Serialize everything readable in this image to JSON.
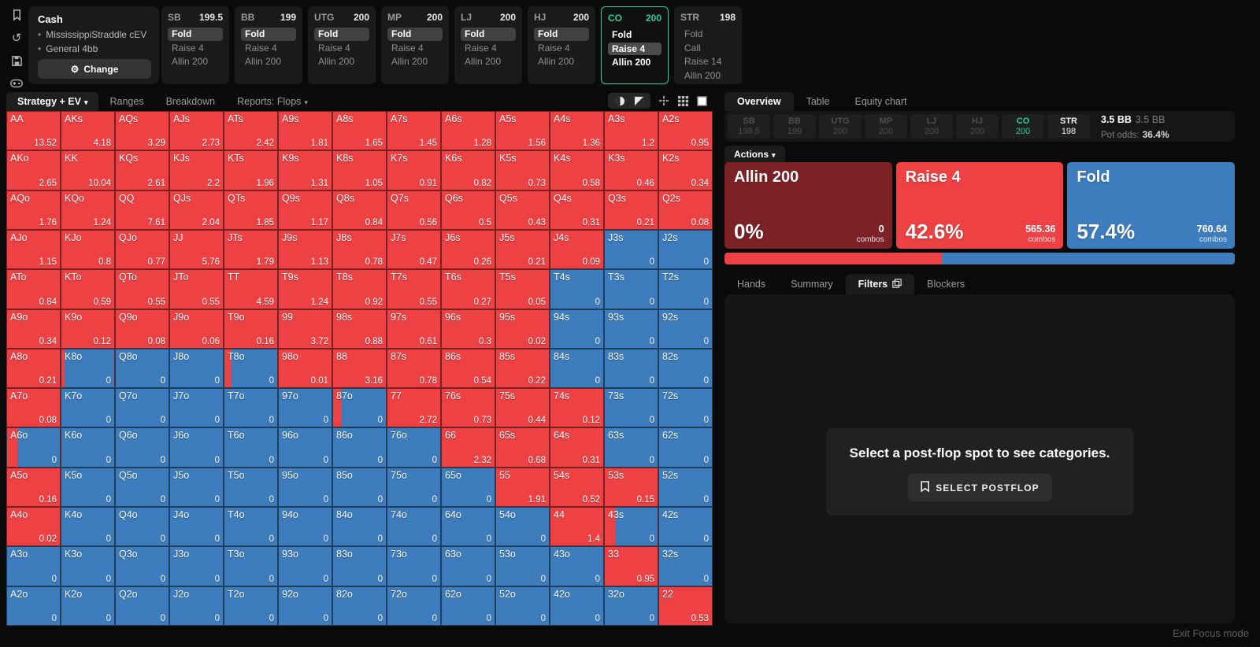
{
  "toolbar_left": {
    "icons": [
      "bookmark-icon",
      "reset-icon",
      "save-icon",
      "gamepad-icon",
      "stack-depth-icon"
    ]
  },
  "config_panel": {
    "title": "Cash",
    "items": [
      "MississippiStraddle cEV",
      "General 4bb"
    ],
    "change_label": "Change",
    "gear_icon": "⚙"
  },
  "position_panels": [
    {
      "name": "SB",
      "stack": "199.5",
      "active": false,
      "actions": [
        {
          "label": "Fold",
          "state": "chosen"
        },
        {
          "label": "Raise 4",
          "state": "dim"
        },
        {
          "label": "Allin 200",
          "state": "dim"
        }
      ]
    },
    {
      "name": "BB",
      "stack": "199",
      "active": false,
      "actions": [
        {
          "label": "Fold",
          "state": "chosen"
        },
        {
          "label": "Raise 4",
          "state": "dim"
        },
        {
          "label": "Allin 200",
          "state": "dim"
        }
      ]
    },
    {
      "name": "UTG",
      "stack": "200",
      "active": false,
      "actions": [
        {
          "label": "Fold",
          "state": "chosen"
        },
        {
          "label": "Raise 4",
          "state": "dim"
        },
        {
          "label": "Allin 200",
          "state": "dim"
        }
      ]
    },
    {
      "name": "MP",
      "stack": "200",
      "active": false,
      "actions": [
        {
          "label": "Fold",
          "state": "chosen"
        },
        {
          "label": "Raise 4",
          "state": "dim"
        },
        {
          "label": "Allin 200",
          "state": "dim"
        }
      ]
    },
    {
      "name": "LJ",
      "stack": "200",
      "active": false,
      "actions": [
        {
          "label": "Fold",
          "state": "chosen"
        },
        {
          "label": "Raise 4",
          "state": "dim"
        },
        {
          "label": "Allin 200",
          "state": "dim"
        }
      ]
    },
    {
      "name": "HJ",
      "stack": "200",
      "active": false,
      "actions": [
        {
          "label": "Fold",
          "state": "chosen"
        },
        {
          "label": "Raise 4",
          "state": "dim"
        },
        {
          "label": "Allin 200",
          "state": "dim"
        }
      ]
    },
    {
      "name": "CO",
      "stack": "200",
      "active": true,
      "actions": [
        {
          "label": "Fold",
          "state": "white"
        },
        {
          "label": "Raise 4",
          "state": "chosen-white"
        },
        {
          "label": "Allin 200",
          "state": "white"
        }
      ]
    },
    {
      "name": "STR",
      "stack": "198",
      "active": false,
      "actions": [
        {
          "label": "Fold",
          "state": "dim"
        },
        {
          "label": "Call",
          "state": "dim"
        },
        {
          "label": "Raise 14",
          "state": "dim"
        },
        {
          "label": "Allin 200",
          "state": "dim"
        }
      ]
    }
  ],
  "left_tabs": {
    "strategy": "Strategy + EV",
    "ranges": "Ranges",
    "breakdown": "Breakdown",
    "reports": "Reports: Flops"
  },
  "matrix_toolbar": {
    "icons": [
      "pie-icon",
      "contrast-square-icon",
      "move-icon",
      "grid-icon",
      "square-icon"
    ]
  },
  "colors": {
    "raise_red": "#ee4144",
    "fold_blue": "#3d7cbd",
    "allin_dark_red": "#7c2125",
    "accent_green": "#25d0a0"
  },
  "matrix": {
    "rows": [
      [
        {
          "h": "AA",
          "v": "13.52",
          "c": "r"
        },
        {
          "h": "AKs",
          "v": "4.18",
          "c": "r"
        },
        {
          "h": "AQs",
          "v": "3.29",
          "c": "r"
        },
        {
          "h": "AJs",
          "v": "2.73",
          "c": "r"
        },
        {
          "h": "ATs",
          "v": "2.42",
          "c": "r"
        },
        {
          "h": "A9s",
          "v": "1.81",
          "c": "r"
        },
        {
          "h": "A8s",
          "v": "1.65",
          "c": "r"
        },
        {
          "h": "A7s",
          "v": "1.45",
          "c": "r"
        },
        {
          "h": "A6s",
          "v": "1.28",
          "c": "r"
        },
        {
          "h": "A5s",
          "v": "1.56",
          "c": "r"
        },
        {
          "h": "A4s",
          "v": "1.36",
          "c": "r"
        },
        {
          "h": "A3s",
          "v": "1.2",
          "c": "r"
        },
        {
          "h": "A2s",
          "v": "0.95",
          "c": "r"
        }
      ],
      [
        {
          "h": "AKo",
          "v": "2.65",
          "c": "r"
        },
        {
          "h": "KK",
          "v": "10.04",
          "c": "r"
        },
        {
          "h": "KQs",
          "v": "2.61",
          "c": "r"
        },
        {
          "h": "KJs",
          "v": "2.2",
          "c": "r"
        },
        {
          "h": "KTs",
          "v": "1.96",
          "c": "r"
        },
        {
          "h": "K9s",
          "v": "1.31",
          "c": "r"
        },
        {
          "h": "K8s",
          "v": "1.05",
          "c": "r"
        },
        {
          "h": "K7s",
          "v": "0.91",
          "c": "r"
        },
        {
          "h": "K6s",
          "v": "0.82",
          "c": "r"
        },
        {
          "h": "K5s",
          "v": "0.73",
          "c": "r"
        },
        {
          "h": "K4s",
          "v": "0.58",
          "c": "r"
        },
        {
          "h": "K3s",
          "v": "0.46",
          "c": "r"
        },
        {
          "h": "K2s",
          "v": "0.34",
          "c": "r"
        }
      ],
      [
        {
          "h": "AQo",
          "v": "1.76",
          "c": "r"
        },
        {
          "h": "KQo",
          "v": "1.24",
          "c": "r"
        },
        {
          "h": "QQ",
          "v": "7.61",
          "c": "r"
        },
        {
          "h": "QJs",
          "v": "2.04",
          "c": "r"
        },
        {
          "h": "QTs",
          "v": "1.85",
          "c": "r"
        },
        {
          "h": "Q9s",
          "v": "1.17",
          "c": "r"
        },
        {
          "h": "Q8s",
          "v": "0.84",
          "c": "r"
        },
        {
          "h": "Q7s",
          "v": "0.56",
          "c": "r"
        },
        {
          "h": "Q6s",
          "v": "0.5",
          "c": "r"
        },
        {
          "h": "Q5s",
          "v": "0.43",
          "c": "r"
        },
        {
          "h": "Q4s",
          "v": "0.31",
          "c": "r"
        },
        {
          "h": "Q3s",
          "v": "0.21",
          "c": "r"
        },
        {
          "h": "Q2s",
          "v": "0.08",
          "c": "r"
        }
      ],
      [
        {
          "h": "AJo",
          "v": "1.15",
          "c": "r"
        },
        {
          "h": "KJo",
          "v": "0.8",
          "c": "r"
        },
        {
          "h": "QJo",
          "v": "0.77",
          "c": "r"
        },
        {
          "h": "JJ",
          "v": "5.76",
          "c": "r"
        },
        {
          "h": "JTs",
          "v": "1.79",
          "c": "r"
        },
        {
          "h": "J9s",
          "v": "1.13",
          "c": "r"
        },
        {
          "h": "J8s",
          "v": "0.78",
          "c": "r"
        },
        {
          "h": "J7s",
          "v": "0.47",
          "c": "r"
        },
        {
          "h": "J6s",
          "v": "0.26",
          "c": "r"
        },
        {
          "h": "J5s",
          "v": "0.21",
          "c": "r"
        },
        {
          "h": "J4s",
          "v": "0.09",
          "c": "r"
        },
        {
          "h": "J3s",
          "v": "0",
          "c": "b"
        },
        {
          "h": "J2s",
          "v": "0",
          "c": "b"
        }
      ],
      [
        {
          "h": "ATo",
          "v": "0.84",
          "c": "r"
        },
        {
          "h": "KTo",
          "v": "0.59",
          "c": "r"
        },
        {
          "h": "QTo",
          "v": "0.55",
          "c": "r"
        },
        {
          "h": "JTo",
          "v": "0.55",
          "c": "r"
        },
        {
          "h": "TT",
          "v": "4.59",
          "c": "r"
        },
        {
          "h": "T9s",
          "v": "1.24",
          "c": "r"
        },
        {
          "h": "T8s",
          "v": "0.92",
          "c": "r"
        },
        {
          "h": "T7s",
          "v": "0.55",
          "c": "r"
        },
        {
          "h": "T6s",
          "v": "0.27",
          "c": "r"
        },
        {
          "h": "T5s",
          "v": "0.05",
          "c": "r"
        },
        {
          "h": "T4s",
          "v": "0",
          "c": "b"
        },
        {
          "h": "T3s",
          "v": "0",
          "c": "b"
        },
        {
          "h": "T2s",
          "v": "0",
          "c": "b"
        }
      ],
      [
        {
          "h": "A9o",
          "v": "0.34",
          "c": "r"
        },
        {
          "h": "K9o",
          "v": "0.12",
          "c": "r"
        },
        {
          "h": "Q9o",
          "v": "0.08",
          "c": "r"
        },
        {
          "h": "J9o",
          "v": "0.06",
          "c": "r"
        },
        {
          "h": "T9o",
          "v": "0.16",
          "c": "r"
        },
        {
          "h": "99",
          "v": "3.72",
          "c": "r"
        },
        {
          "h": "98s",
          "v": "0.88",
          "c": "r"
        },
        {
          "h": "97s",
          "v": "0.61",
          "c": "r"
        },
        {
          "h": "96s",
          "v": "0.3",
          "c": "r"
        },
        {
          "h": "95s",
          "v": "0.02",
          "c": "r"
        },
        {
          "h": "94s",
          "v": "0",
          "c": "b"
        },
        {
          "h": "93s",
          "v": "0",
          "c": "b"
        },
        {
          "h": "92s",
          "v": "0",
          "c": "b"
        }
      ],
      [
        {
          "h": "A8o",
          "v": "0.21",
          "c": "r"
        },
        {
          "h": "K8o",
          "v": "0",
          "c": "m",
          "f": 0.06
        },
        {
          "h": "Q8o",
          "v": "0",
          "c": "b"
        },
        {
          "h": "J8o",
          "v": "0",
          "c": "b"
        },
        {
          "h": "T8o",
          "v": "0",
          "c": "m",
          "f": 0.13
        },
        {
          "h": "98o",
          "v": "0.01",
          "c": "r"
        },
        {
          "h": "88",
          "v": "3.16",
          "c": "r"
        },
        {
          "h": "87s",
          "v": "0.78",
          "c": "r"
        },
        {
          "h": "86s",
          "v": "0.54",
          "c": "r"
        },
        {
          "h": "85s",
          "v": "0.22",
          "c": "r"
        },
        {
          "h": "84s",
          "v": "0",
          "c": "b"
        },
        {
          "h": "83s",
          "v": "0",
          "c": "b"
        },
        {
          "h": "82s",
          "v": "0",
          "c": "b"
        }
      ],
      [
        {
          "h": "A7o",
          "v": "0.08",
          "c": "r"
        },
        {
          "h": "K7o",
          "v": "0",
          "c": "b"
        },
        {
          "h": "Q7o",
          "v": "0",
          "c": "b"
        },
        {
          "h": "J7o",
          "v": "0",
          "c": "b"
        },
        {
          "h": "T7o",
          "v": "0",
          "c": "b"
        },
        {
          "h": "97o",
          "v": "0",
          "c": "b"
        },
        {
          "h": "87o",
          "v": "0",
          "c": "m",
          "f": 0.16
        },
        {
          "h": "77",
          "v": "2.72",
          "c": "r"
        },
        {
          "h": "76s",
          "v": "0.73",
          "c": "r"
        },
        {
          "h": "75s",
          "v": "0.44",
          "c": "r"
        },
        {
          "h": "74s",
          "v": "0.12",
          "c": "r"
        },
        {
          "h": "73s",
          "v": "0",
          "c": "b"
        },
        {
          "h": "72s",
          "v": "0",
          "c": "b"
        }
      ],
      [
        {
          "h": "A6o",
          "v": "0",
          "c": "m",
          "f": 0.2
        },
        {
          "h": "K6o",
          "v": "0",
          "c": "b"
        },
        {
          "h": "Q6o",
          "v": "0",
          "c": "b"
        },
        {
          "h": "J6o",
          "v": "0",
          "c": "b"
        },
        {
          "h": "T6o",
          "v": "0",
          "c": "b"
        },
        {
          "h": "96o",
          "v": "0",
          "c": "b"
        },
        {
          "h": "86o",
          "v": "0",
          "c": "b"
        },
        {
          "h": "76o",
          "v": "0",
          "c": "b"
        },
        {
          "h": "66",
          "v": "2.32",
          "c": "r"
        },
        {
          "h": "65s",
          "v": "0.68",
          "c": "r"
        },
        {
          "h": "64s",
          "v": "0.31",
          "c": "r"
        },
        {
          "h": "63s",
          "v": "0",
          "c": "b"
        },
        {
          "h": "62s",
          "v": "0",
          "c": "b"
        }
      ],
      [
        {
          "h": "A5o",
          "v": "0.16",
          "c": "r"
        },
        {
          "h": "K5o",
          "v": "0",
          "c": "b"
        },
        {
          "h": "Q5o",
          "v": "0",
          "c": "b"
        },
        {
          "h": "J5o",
          "v": "0",
          "c": "b"
        },
        {
          "h": "T5o",
          "v": "0",
          "c": "b"
        },
        {
          "h": "95o",
          "v": "0",
          "c": "b"
        },
        {
          "h": "85o",
          "v": "0",
          "c": "b"
        },
        {
          "h": "75o",
          "v": "0",
          "c": "b"
        },
        {
          "h": "65o",
          "v": "0",
          "c": "b"
        },
        {
          "h": "55",
          "v": "1.91",
          "c": "r"
        },
        {
          "h": "54s",
          "v": "0.52",
          "c": "r"
        },
        {
          "h": "53s",
          "v": "0.15",
          "c": "r"
        },
        {
          "h": "52s",
          "v": "0",
          "c": "b"
        }
      ],
      [
        {
          "h": "A4o",
          "v": "0.02",
          "c": "r"
        },
        {
          "h": "K4o",
          "v": "0",
          "c": "b"
        },
        {
          "h": "Q4o",
          "v": "0",
          "c": "b"
        },
        {
          "h": "J4o",
          "v": "0",
          "c": "b"
        },
        {
          "h": "T4o",
          "v": "0",
          "c": "b"
        },
        {
          "h": "94o",
          "v": "0",
          "c": "b"
        },
        {
          "h": "84o",
          "v": "0",
          "c": "b"
        },
        {
          "h": "74o",
          "v": "0",
          "c": "b"
        },
        {
          "h": "64o",
          "v": "0",
          "c": "b"
        },
        {
          "h": "54o",
          "v": "0",
          "c": "b"
        },
        {
          "h": "44",
          "v": "1.4",
          "c": "r"
        },
        {
          "h": "43s",
          "v": "0",
          "c": "m",
          "f": 0.2
        },
        {
          "h": "42s",
          "v": "0",
          "c": "b"
        }
      ],
      [
        {
          "h": "A3o",
          "v": "0",
          "c": "b"
        },
        {
          "h": "K3o",
          "v": "0",
          "c": "b"
        },
        {
          "h": "Q3o",
          "v": "0",
          "c": "b"
        },
        {
          "h": "J3o",
          "v": "0",
          "c": "b"
        },
        {
          "h": "T3o",
          "v": "0",
          "c": "b"
        },
        {
          "h": "93o",
          "v": "0",
          "c": "b"
        },
        {
          "h": "83o",
          "v": "0",
          "c": "b"
        },
        {
          "h": "73o",
          "v": "0",
          "c": "b"
        },
        {
          "h": "63o",
          "v": "0",
          "c": "b"
        },
        {
          "h": "53o",
          "v": "0",
          "c": "b"
        },
        {
          "h": "43o",
          "v": "0",
          "c": "b"
        },
        {
          "h": "33",
          "v": "0.95",
          "c": "r"
        },
        {
          "h": "32s",
          "v": "0",
          "c": "b"
        }
      ],
      [
        {
          "h": "A2o",
          "v": "0",
          "c": "b"
        },
        {
          "h": "K2o",
          "v": "0",
          "c": "b"
        },
        {
          "h": "Q2o",
          "v": "0",
          "c": "b"
        },
        {
          "h": "J2o",
          "v": "0",
          "c": "b"
        },
        {
          "h": "T2o",
          "v": "0",
          "c": "b"
        },
        {
          "h": "92o",
          "v": "0",
          "c": "b"
        },
        {
          "h": "82o",
          "v": "0",
          "c": "b"
        },
        {
          "h": "72o",
          "v": "0",
          "c": "b"
        },
        {
          "h": "62o",
          "v": "0",
          "c": "b"
        },
        {
          "h": "52o",
          "v": "0",
          "c": "b"
        },
        {
          "h": "42o",
          "v": "0",
          "c": "b"
        },
        {
          "h": "32o",
          "v": "0",
          "c": "b"
        },
        {
          "h": "22",
          "v": "0.53",
          "c": "r"
        }
      ]
    ]
  },
  "right_panel": {
    "tabs": {
      "overview": "Overview",
      "table": "Table",
      "equity": "Equity chart"
    },
    "badges": [
      {
        "name": "SB",
        "stack": "199.5",
        "state": "dim"
      },
      {
        "name": "BB",
        "stack": "199",
        "state": "dim"
      },
      {
        "name": "UTG",
        "stack": "200",
        "state": "dim"
      },
      {
        "name": "MP",
        "stack": "200",
        "state": "dim"
      },
      {
        "name": "LJ",
        "stack": "200",
        "state": "dim"
      },
      {
        "name": "HJ",
        "stack": "200",
        "state": "dim"
      },
      {
        "name": "CO",
        "stack": "200",
        "state": "green"
      },
      {
        "name": "STR",
        "stack": "198",
        "state": "white"
      }
    ],
    "pot": {
      "bb_bold": "3.5 BB",
      "bb_dim": "3.5 BB",
      "pot_odds_label": "Pot odds:",
      "pot_odds": "36.4%"
    },
    "actions_label": "Actions",
    "combos_label": "combos",
    "action_cards": [
      {
        "title": "Allin 200",
        "pct": "0%",
        "combos": "0",
        "bg": "#7c2125"
      },
      {
        "title": "Raise 4",
        "pct": "42.6%",
        "combos": "565.36",
        "bg": "#ee4144"
      },
      {
        "title": "Fold",
        "pct": "57.4%",
        "combos": "760.64",
        "bg": "#3d7cbd"
      }
    ],
    "strategy_bar": {
      "red_pct": 42.6,
      "blue_pct": 57.4
    },
    "sub_tabs": {
      "hands": "Hands",
      "summary": "Summary",
      "filters": "Filters",
      "blockers": "Blockers"
    },
    "empty_state": {
      "message": "Select a post-flop spot to see categories.",
      "button": "SELECT POSTFLOP"
    }
  },
  "footer": {
    "exit_label": "Exit Focus mode"
  }
}
